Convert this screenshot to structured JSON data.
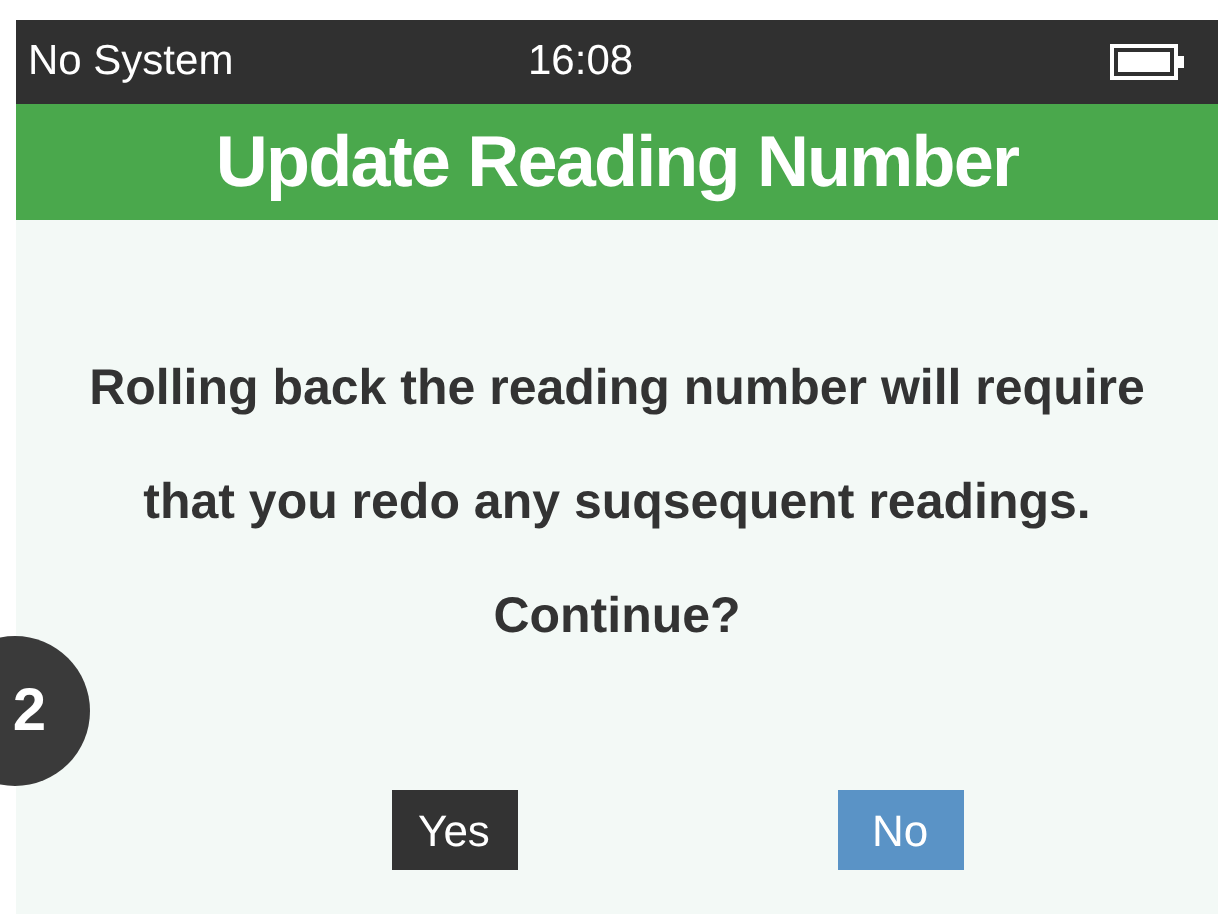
{
  "status_bar": {
    "system": "No System",
    "time": "16:08"
  },
  "header": {
    "title": "Update Reading Number"
  },
  "message": "Rolling back the reading number will require that you redo any suqsequent readings. Continue?",
  "callout": "2",
  "buttons": [
    {
      "label": "Yes",
      "selected": false
    },
    {
      "label": "No",
      "selected": true
    }
  ]
}
